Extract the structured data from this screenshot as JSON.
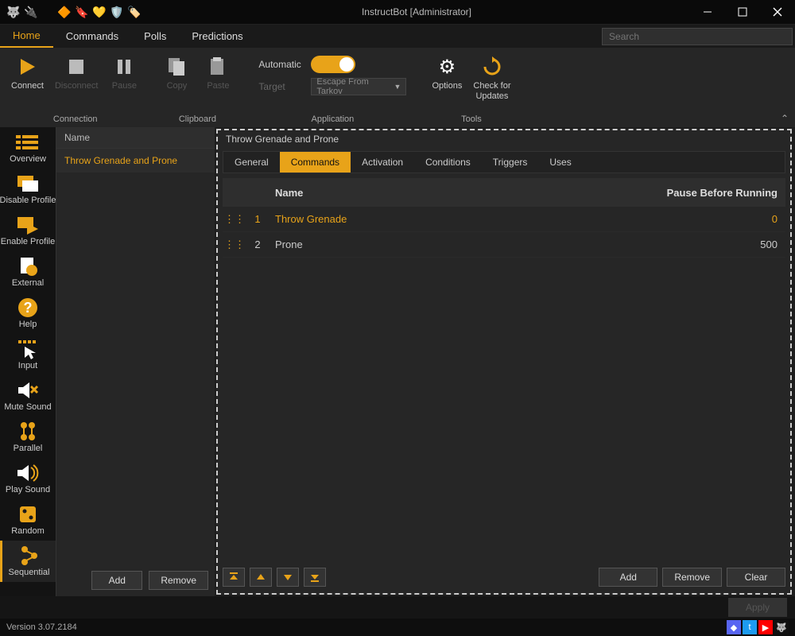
{
  "window": {
    "title": "InstructBot [Administrator]"
  },
  "menubar": {
    "tabs": [
      "Home",
      "Commands",
      "Polls",
      "Predictions"
    ],
    "search_placeholder": "Search"
  },
  "ribbon": {
    "connection": {
      "label": "Connection",
      "connect": "Connect",
      "disconnect": "Disconnect",
      "pause": "Pause"
    },
    "clipboard": {
      "label": "Clipboard",
      "copy": "Copy",
      "paste": "Paste"
    },
    "application": {
      "label": "Application",
      "automatic": "Automatic",
      "target": "Target",
      "target_value": "Escape From Tarkov"
    },
    "tools": {
      "label": "Tools",
      "options": "Options",
      "check": "Check for\nUpdates"
    }
  },
  "rail": {
    "items": [
      {
        "label": "Overview"
      },
      {
        "label": "Disable Profile"
      },
      {
        "label": "Enable Profile"
      },
      {
        "label": "External"
      },
      {
        "label": "Help"
      },
      {
        "label": "Input"
      },
      {
        "label": "Mute Sound"
      },
      {
        "label": "Parallel"
      },
      {
        "label": "Play Sound"
      },
      {
        "label": "Random"
      },
      {
        "label": "Sequential"
      }
    ]
  },
  "list": {
    "header": "Name",
    "rows": [
      "Throw Grenade and Prone"
    ],
    "add": "Add",
    "remove": "Remove"
  },
  "editor": {
    "title": "Throw Grenade and Prone",
    "tabs": [
      "General",
      "Commands",
      "Activation",
      "Conditions",
      "Triggers",
      "Uses"
    ],
    "columns": {
      "name": "Name",
      "pause": "Pause Before Running"
    },
    "rows": [
      {
        "idx": "1",
        "name": "Throw Grenade",
        "pause": "0"
      },
      {
        "idx": "2",
        "name": "Prone",
        "pause": "500"
      }
    ],
    "add": "Add",
    "remove": "Remove",
    "clear": "Clear",
    "apply": "Apply"
  },
  "status": {
    "version": "Version 3.07.2184"
  }
}
